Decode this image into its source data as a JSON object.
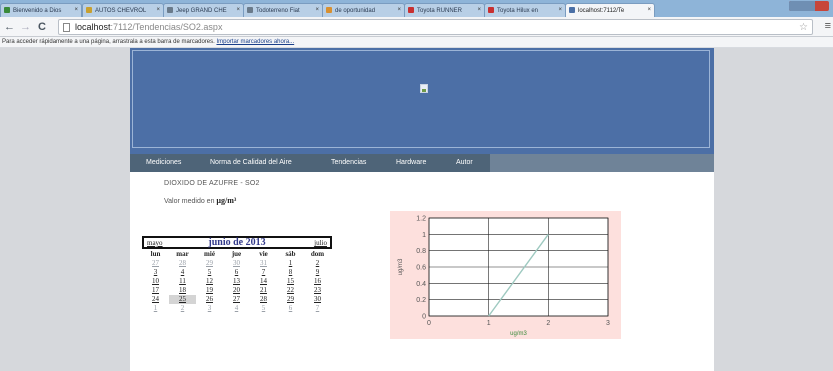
{
  "browser": {
    "tabs": [
      {
        "label": "Bienvenido a Dios",
        "color": "#3a8a3a"
      },
      {
        "label": "AUTOS CHEVROL",
        "color": "#c8a030"
      },
      {
        "label": "Jeep GRAND CHE",
        "color": "#6a7a8a"
      },
      {
        "label": "Todoterreno Fiat",
        "color": "#6a7a8a"
      },
      {
        "label": "de oportunidad",
        "color": "#d89030"
      },
      {
        "label": "Toyota RUNNER",
        "color": "#c83030"
      },
      {
        "label": "Toyota Hilux en",
        "color": "#c83030"
      },
      {
        "label": "localhost:7112/Te",
        "color": "#4a6fa6"
      }
    ],
    "url_host": "localhost",
    "url_path": ":7112/Tendencias/SO2.aspx",
    "bookmarks_text": "Para acceder rápidamente a una página, arrastrala a esta barra de marcadores.",
    "bookmarks_link": "Importar marcadores ahora..."
  },
  "nav": [
    "Mediciones",
    "Norma de Calidad del Aire",
    "Tendencias",
    "Hardware",
    "Autor"
  ],
  "content": {
    "title": "DIOXIDO DE AZUFRE - SO2",
    "valor_label": "Valor medido en",
    "valor_unit": "µg/m³"
  },
  "calendar": {
    "prev": "mayo",
    "title": "junio de 2013",
    "next": "julio",
    "weekdays": [
      "lun",
      "mar",
      "mié",
      "jue",
      "vie",
      "sáb",
      "dom"
    ],
    "weeks": [
      [
        "27",
        "28",
        "29",
        "30",
        "31",
        "1",
        "2"
      ],
      [
        "3",
        "4",
        "5",
        "6",
        "7",
        "8",
        "9"
      ],
      [
        "10",
        "11",
        "12",
        "13",
        "14",
        "15",
        "16"
      ],
      [
        "17",
        "18",
        "19",
        "20",
        "21",
        "22",
        "23"
      ],
      [
        "24",
        "25",
        "26",
        "27",
        "28",
        "29",
        "30"
      ],
      [
        "1",
        "2",
        "3",
        "4",
        "5",
        "6",
        "7"
      ]
    ],
    "other_month": [
      [
        0,
        0
      ],
      [
        0,
        1
      ],
      [
        0,
        2
      ],
      [
        0,
        3
      ],
      [
        0,
        4
      ],
      [
        5,
        0
      ],
      [
        5,
        1
      ],
      [
        5,
        2
      ],
      [
        5,
        3
      ],
      [
        5,
        4
      ],
      [
        5,
        5
      ],
      [
        5,
        6
      ]
    ],
    "today": [
      4,
      1
    ]
  },
  "chart_data": {
    "type": "line",
    "xlabel": "ug/m3",
    "ylabel": "ug/m3",
    "xlim": [
      0,
      3
    ],
    "ylim": [
      0,
      1.2
    ],
    "x_ticks": [
      "0",
      "1",
      "2",
      "3"
    ],
    "y_ticks": [
      "0",
      "0.2",
      "0.4",
      "0.6",
      "0.8",
      "1",
      "1.2"
    ],
    "grid": true,
    "series": [
      {
        "x": [
          1,
          2
        ],
        "y": [
          0,
          1
        ],
        "color": "#9ec9c0"
      }
    ]
  }
}
